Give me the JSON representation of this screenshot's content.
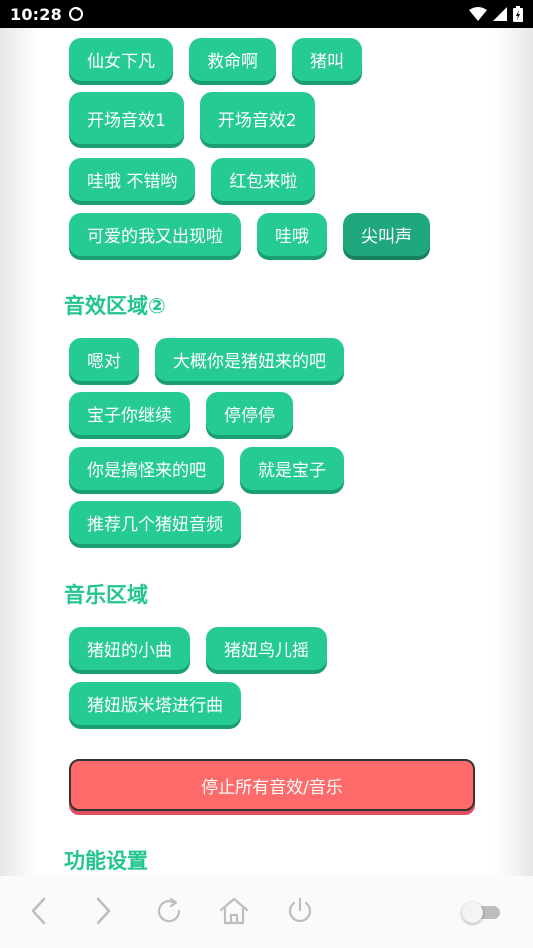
{
  "status_bar": {
    "time": "10:28"
  },
  "section1": {
    "rows": [
      [
        "仙女下凡",
        "救命啊",
        "猪叫"
      ],
      [
        "开场音效1",
        "开场音效2"
      ],
      [
        "哇哦 不错哟",
        "红包来啦"
      ],
      [
        "可爱的我又出现啦",
        "哇哦",
        "尖叫声"
      ]
    ]
  },
  "section2": {
    "title": "音效区域②",
    "rows": [
      [
        "嗯对",
        "大概你是猪妞来的吧"
      ],
      [
        "宝子你继续",
        "停停停"
      ],
      [
        "你是搞怪来的吧",
        "就是宝子"
      ],
      [
        "推荐几个猪妞音频"
      ]
    ]
  },
  "section3": {
    "title": "音乐区域",
    "rows": [
      [
        "猪妞的小曲",
        "猪妞鸟儿摇"
      ],
      [
        "猪妞版米塔进行曲"
      ]
    ]
  },
  "stop_button": {
    "label": "停止所有音效/音乐"
  },
  "section4": {
    "title": "功能设置"
  },
  "colors": {
    "accent": "#26cb94",
    "title": "#22c58c",
    "stop": "#ff6b6b"
  }
}
